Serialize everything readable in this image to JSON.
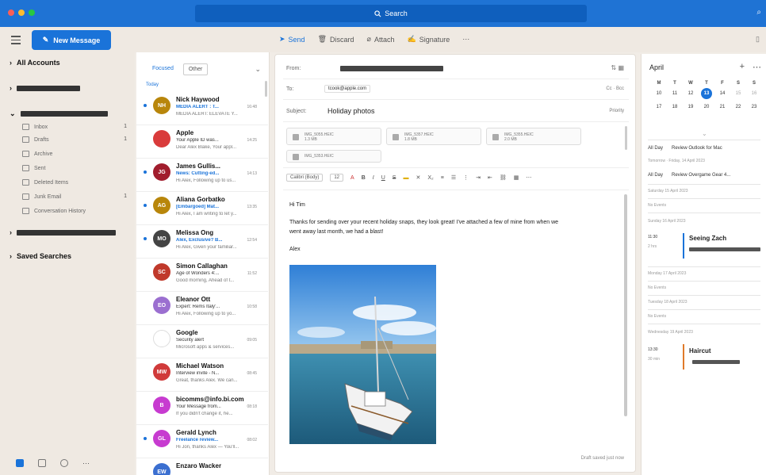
{
  "window": {
    "search_placeholder": "Search"
  },
  "toolbar": {
    "new_message": "New Message",
    "send": "Send",
    "discard": "Discard",
    "attach": "Attach",
    "signature": "Signature"
  },
  "sidebar": {
    "all_accounts": "All Accounts",
    "folders": [
      {
        "label": "Inbox",
        "count": "1"
      },
      {
        "label": "Drafts",
        "count": "1"
      },
      {
        "label": "Archive",
        "count": ""
      },
      {
        "label": "Sent",
        "count": ""
      },
      {
        "label": "Deleted Items",
        "count": ""
      },
      {
        "label": "Junk Email",
        "count": "1"
      },
      {
        "label": "Conversation History",
        "count": ""
      }
    ],
    "saved_searches": "Saved Searches"
  },
  "message_list": {
    "tab_focused": "Focused",
    "tab_other": "Other",
    "group_today": "Today",
    "messages": [
      {
        "initials": "NH",
        "color": "#b8860b",
        "sender": "Nick Haywood",
        "subject": "MEDIA ALERT : T...",
        "time": "16:48",
        "preview": "MEDIA ALERT: ELEVATE Y...",
        "accent": true,
        "unread": true
      },
      {
        "initials": "",
        "color": "#d93b3b",
        "sender": "Apple",
        "subject": "Your Apple ID was...",
        "time": "14:25",
        "preview": "Dear Alex Blake, Your appl...",
        "accent": false,
        "unread": false
      },
      {
        "initials": "JG",
        "color": "#a11d2d",
        "sender": "James Gullis...",
        "subject": "News: Cutting-ed...",
        "time": "14:13",
        "preview": "Hi Alex, Following up to us...",
        "accent": true,
        "unread": true
      },
      {
        "initials": "AG",
        "color": "#b8860b",
        "sender": "Aliana Gorbatko",
        "subject": "[Embargoed] Mat...",
        "time": "13:35",
        "preview": "Hi Alex, I am writing to let y...",
        "accent": true,
        "unread": true
      },
      {
        "initials": "MO",
        "color": "#444444",
        "sender": "Melissa Ong",
        "subject": "Alex, Exclusive? B...",
        "time": "12:54",
        "preview": "Hi Alex, Given your familiar...",
        "accent": true,
        "unread": true
      },
      {
        "initials": "SC",
        "color": "#c0392b",
        "sender": "Simon Callaghan",
        "subject": "Age of Wonders 4:...",
        "time": "11:52",
        "preview": "Good morning, Ahead of t...",
        "accent": false,
        "unread": false
      },
      {
        "initials": "EO",
        "color": "#9b6fd0",
        "sender": "Eleanor Ott",
        "subject": "Expert: Rems Italy'...",
        "time": "10:58",
        "preview": "Hi Alex, Following up to yo...",
        "accent": false,
        "unread": false
      },
      {
        "initials": "",
        "color": "#ffffff",
        "sender": "Google",
        "subject": "Security alert",
        "time": "09:05",
        "preview": "Microsoft apps & services...",
        "accent": false,
        "unread": false
      },
      {
        "initials": "MW",
        "color": "#d03a3a",
        "sender": "Michael Watson",
        "subject": "Interview invite - N...",
        "time": "08:45",
        "preview": "Great, thanks Alex. We can...",
        "accent": false,
        "unread": false
      },
      {
        "initials": "B",
        "color": "#c73bd0",
        "sender": "bicomms@info.bi.com",
        "subject": "Your Message from...",
        "time": "08:18",
        "preview": "If you didn't change it, he...",
        "accent": false,
        "unread": false
      },
      {
        "initials": "GL",
        "color": "#c73bd0",
        "sender": "Gerald Lynch",
        "subject": "Freelance review...",
        "time": "08:02",
        "preview": "Hi Jon, thanks Alex — You'll...",
        "accent": true,
        "unread": true
      },
      {
        "initials": "EW",
        "color": "#3b6fd0",
        "sender": "Enzaro Wacker",
        "subject": "",
        "time": "",
        "preview": "",
        "accent": false,
        "unread": false
      }
    ]
  },
  "compose": {
    "from_label": "From:",
    "to_label": "To:",
    "to_value": "tcook@apple.com",
    "bcc_label": "Bcc",
    "subject_label": "Subject:",
    "subject_value": "Holiday photos",
    "priority": "Priority",
    "attachments": [
      {
        "name": "IMG_5055.HEIC",
        "size": "1.3 MB"
      },
      {
        "name": "IMG_5357.HEIC",
        "size": "1.8 MB"
      },
      {
        "name": "IMG_5355.HEIC",
        "size": "2.0 MB"
      },
      {
        "name": "IMG_5353.HEIC",
        "size": ""
      }
    ],
    "font_select": "Calibri (Body)",
    "font_size": "12",
    "greeting": "Hi Tim",
    "body": "Thanks for sending over your recent holiday snaps, they look great! I've attached a few of mine from when we",
    "body2": "went away last month, we had a blast!",
    "signoff": "Alex",
    "footer": "Draft saved just now"
  },
  "calendar": {
    "month": "April",
    "weekdays": [
      "M",
      "T",
      "W",
      "T",
      "F",
      "S",
      "S"
    ],
    "days": [
      "10",
      "11",
      "12",
      "13",
      "14",
      "15",
      "16",
      "17",
      "18",
      "19",
      "20",
      "21",
      "22",
      "23"
    ],
    "today": "13",
    "events": {
      "all_day_1": "All Day",
      "ev1": "Review Outlook for Mac",
      "tomorrow": "Tomorrow · Friday, 14 April 2023",
      "all_day_2": "All Day",
      "ev2": "Review Overgame Gear 4...",
      "saturday": "Saturday 15 April 2023",
      "no_events_1": "No Events",
      "sunday": "Sunday 16 April 2023",
      "time1": "11:30",
      "dur1": "2 hrs",
      "title1": "Seeing Zach",
      "monday": "Monday 17 April 2023",
      "no_events_2": "No Events",
      "tuesday": "Tuesday 18 April 2023",
      "no_events_3": "No Events",
      "wednesday": "Wednesday 19 April 2023",
      "time2": "13:30",
      "dur2": "30 min",
      "title2": "Haircut"
    }
  }
}
